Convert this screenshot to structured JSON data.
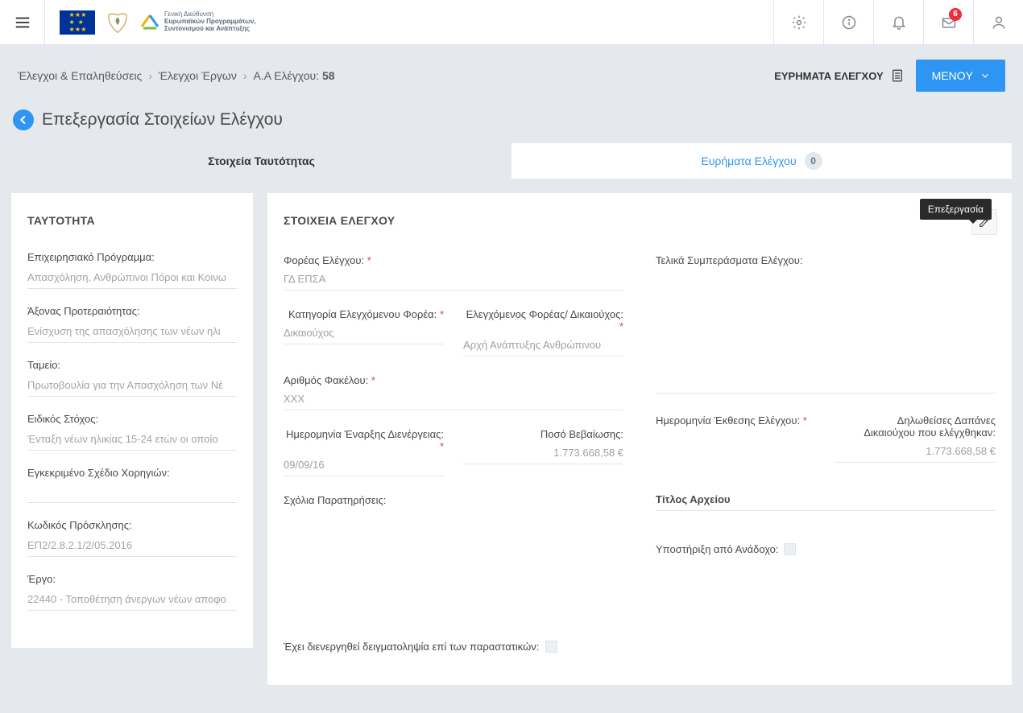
{
  "header": {
    "org_text_l1": "Γενική Διεύθυνση",
    "org_text_l2": "Ευρωπαϊκών Προγραμμάτων,",
    "org_text_l3": "Συντονισμού και Ανάπτυξης",
    "badge_count": "6"
  },
  "breadcrumb": {
    "l1": "Έλεγχοι & Επαληθεύσεις",
    "l2": "Έλεγχοι Έργων",
    "l3_prefix": "Α.Α Ελέγχου:",
    "l3_num": "58",
    "findings_label": "ΕΥΡΗΜΑΤΑ ΕΛΕΓΧΟΥ",
    "menu_label": "MENOY"
  },
  "title": "Επεξεργασία Στοιχείων Ελέγχου",
  "tabs": {
    "t1": "Στοιχεία Ταυτότητας",
    "t2": "Ευρήματα Ελέγχου",
    "t2_count": "0"
  },
  "identity": {
    "heading": "ΤΑΥΤΟΤΗΤΑ",
    "f1_label": "Επιχειρησιακό Πρόγραμμα:",
    "f1_value": "Απασχόληση, Ανθρώπινοι Πόροι και Κοινω",
    "f2_label": "Άξονας Προτεραιότητας:",
    "f2_value": "Ενίσχυση της απασχόλησης των νέων ηλι",
    "f3_label": "Ταμείο:",
    "f3_value": "Πρωτοβουλία για την Απασχόληση των Νέ",
    "f4_label": "Ειδικός Στόχος:",
    "f4_value": "Ένταξη νέων ηλικίας 15-24 ετών οι οποίο",
    "f5_label": "Εγκεκριμένο Σχέδιο Χορηγιών:",
    "f5_value": "",
    "f6_label": "Κωδικός Πρόσκλησης:",
    "f6_value": "ΕΠ2/2.8.2.1/2/05.2016",
    "f7_label": "Έργο:",
    "f7_value": "22440 - Τοποθέτηση άνεργων νέων αποφο"
  },
  "details": {
    "heading": "ΣΤΟΙΧΕΙΑ ΕΛΕΓΧΟΥ",
    "edit_tooltip": "Επεξεργασία",
    "f_body_label": "Φορέας Ελέγχου:",
    "f_body_value": "ΓΔ ΕΠΣΑ",
    "f_cat_label": "Κατηγορία Ελεγχόμενου Φορέα:",
    "f_cat_value": "Δικαιούχος",
    "f_controlled_label": "Ελεγχόμενος Φορέας/ Δικαιούχος:",
    "f_controlled_value": "Αρχή Ανάπτυξης Ανθρώπινου",
    "f_file_label": "Αριθμός Φακέλου:",
    "f_file_value": "ΧΧΧ",
    "f_start_label": "Ημερομηνία Έναρξης Διενέργειας:",
    "f_start_value": "09/09/16",
    "f_amount_label": "Ποσό Βεβαίωσης:",
    "f_amount_value": "1.773.668,58 €",
    "f_comments_label": "Σχόλια Παρατηρήσεις:",
    "f_sampling_label": "Έχει διενεργηθεί δειγματοληψία επί των παραστατικών:",
    "f_conclusions_label": "Τελικά Συμπεράσματα Ελέγχου:",
    "f_report_date_label": "Ημερομηνία Έκθεσης Ελέγχου:",
    "f_declared_label_l1": "Δηλωθείσες Δαπάνες",
    "f_declared_label_l2": "Δικαιούχου που ελέγχθηκαν:",
    "f_declared_value": "1.773.668,58 €",
    "f_file_title_label": "Τίτλος Αρχείου",
    "f_support_label": "Υποστήριξη από Ανάδοχο:"
  }
}
